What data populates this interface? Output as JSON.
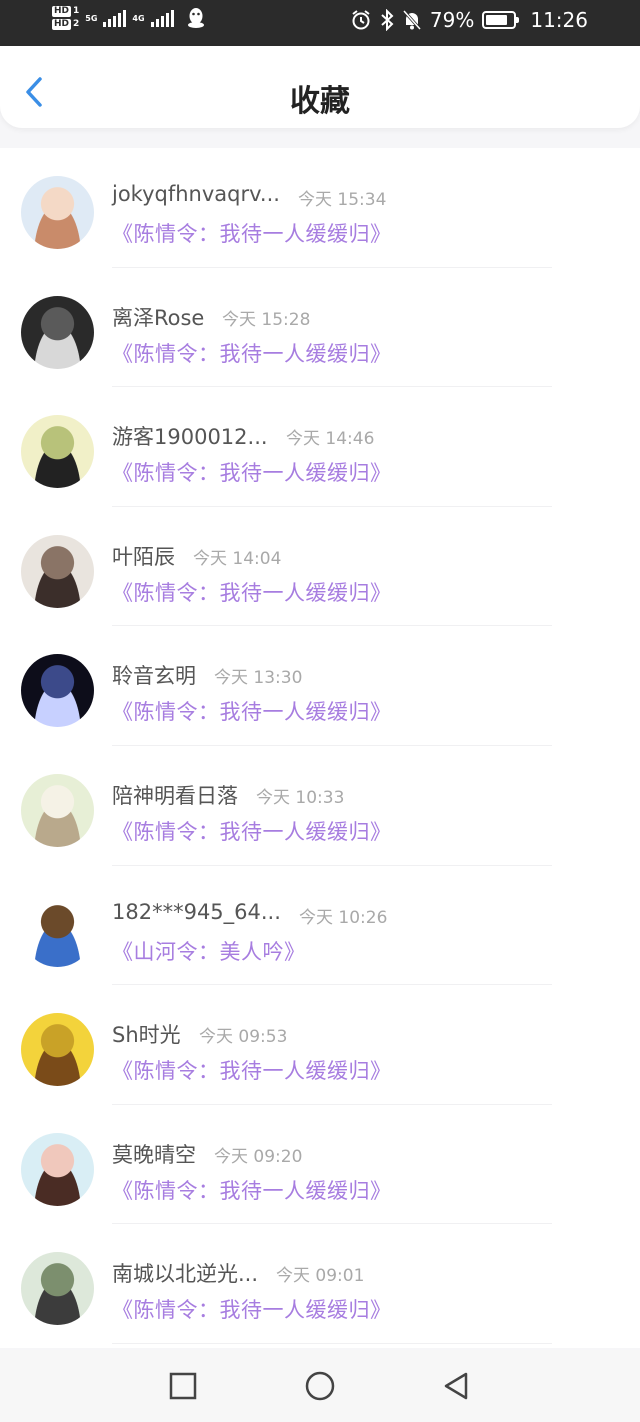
{
  "status_bar": {
    "hd1": "HD",
    "hd1_num": "1",
    "hd2": "HD",
    "hd2_num": "2",
    "net1": "5G",
    "net2": "4G",
    "battery_percent": "79%",
    "time": "11:26",
    "battery_level": 0.79,
    "icons": [
      "qq-penguin-icon",
      "alarm-icon",
      "bluetooth-icon",
      "mute-bell-icon",
      "battery-icon"
    ]
  },
  "header": {
    "title": "收藏",
    "back_icon": "chevron-left-icon",
    "accent_color": "#3a8ee6"
  },
  "favorites": [
    {
      "name": "jokyqfhnvaqrv...",
      "time": "今天 15:34",
      "work": "《陈情令：我待一人缓缓归》"
    },
    {
      "name": "离泽Rose",
      "time": "今天 15:28",
      "work": "《陈情令：我待一人缓缓归》"
    },
    {
      "name": "游客1900012...",
      "time": "今天 14:46",
      "work": "《陈情令：我待一人缓缓归》"
    },
    {
      "name": "叶陌辰",
      "time": "今天 14:04",
      "work": "《陈情令：我待一人缓缓归》"
    },
    {
      "name": "聆音玄明",
      "time": "今天 13:30",
      "work": "《陈情令：我待一人缓缓归》"
    },
    {
      "name": "陪神明看日落",
      "time": "今天 10:33",
      "work": "《陈情令：我待一人缓缓归》"
    },
    {
      "name": "182***945_64...",
      "time": "今天 10:26",
      "work": "《山河令：美人吟》"
    },
    {
      "name": "Sh时光",
      "time": "今天 09:53",
      "work": "《陈情令：我待一人缓缓归》"
    },
    {
      "name": "莫晚晴空",
      "time": "今天 09:20",
      "work": "《陈情令：我待一人缓缓归》"
    },
    {
      "name": "南城以北逆光...",
      "time": "今天 09:01",
      "work": "《陈情令：我待一人缓缓归》"
    }
  ],
  "colors": {
    "work_title": "#a77de0",
    "name": "#555555",
    "time": "#a9a9a9"
  },
  "nav_bar": {
    "icons": [
      "recents-square-icon",
      "home-circle-icon",
      "back-triangle-icon"
    ]
  }
}
